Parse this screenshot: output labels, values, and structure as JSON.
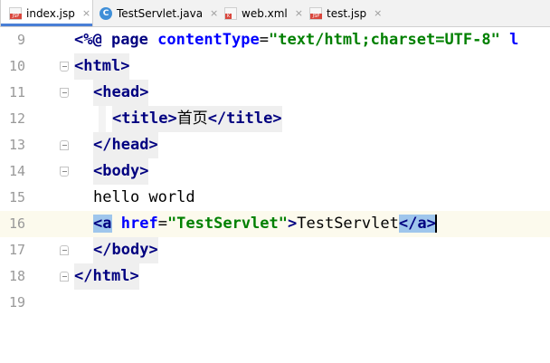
{
  "tabs": [
    {
      "label": "index.jsp",
      "icon": "jsp-file-icon",
      "close": "×",
      "active": true
    },
    {
      "label": "TestServlet.java",
      "icon": "java-class-icon",
      "close": "×",
      "active": false
    },
    {
      "label": "web.xml",
      "icon": "xml-file-icon",
      "close": "×",
      "active": false
    },
    {
      "label": "test.jsp",
      "icon": "jsp-file-icon",
      "close": "×",
      "active": false
    }
  ],
  "icons": {
    "jsp_label": "JSP",
    "java_label": "C",
    "xml_label": "K"
  },
  "editor": {
    "current_line": 16,
    "lines": [
      {
        "num": "9",
        "p": [
          "<%@ ",
          "page ",
          "contentType",
          "=",
          "\"text/html;charset=UTF-8\"",
          " l"
        ]
      },
      {
        "num": "10",
        "p": [
          "<",
          "html",
          ">"
        ]
      },
      {
        "num": "11",
        "p": [
          "<",
          "head",
          ">"
        ]
      },
      {
        "num": "12",
        "p": [
          "<",
          "title",
          ">",
          "首页",
          "</",
          "title",
          ">"
        ]
      },
      {
        "num": "13",
        "p": [
          "</",
          "head",
          ">"
        ]
      },
      {
        "num": "14",
        "p": [
          "<",
          "body",
          ">"
        ]
      },
      {
        "num": "15",
        "p": [
          "hello world"
        ]
      },
      {
        "num": "16",
        "p": [
          "<",
          "a",
          " href",
          "=",
          "\"TestServlet\"",
          ">",
          "TestServlet",
          "</",
          "a",
          ">"
        ]
      },
      {
        "num": "17",
        "p": [
          "</",
          "body",
          ">"
        ]
      },
      {
        "num": "18",
        "p": [
          "</",
          "html",
          ">"
        ]
      },
      {
        "num": "19",
        "p": []
      }
    ]
  }
}
